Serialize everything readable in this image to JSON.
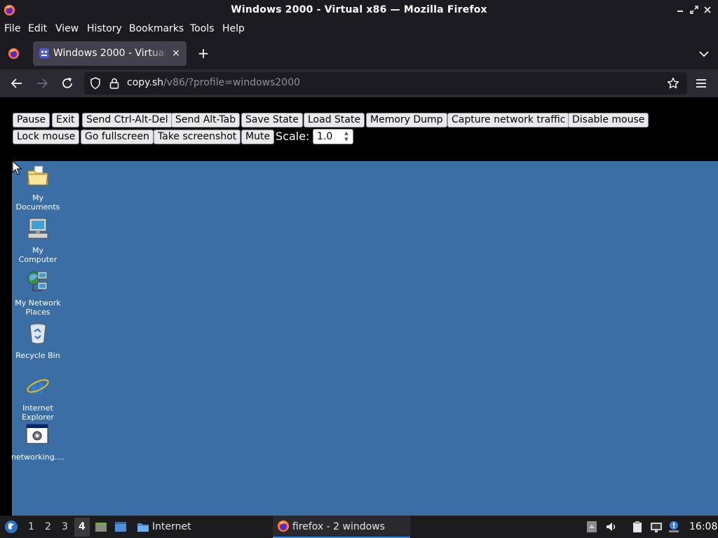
{
  "window": {
    "title": "Windows 2000 - Virtual x86 — Mozilla Firefox",
    "controls": [
      "minimize",
      "maximize",
      "close"
    ]
  },
  "menubar": {
    "items": [
      "File",
      "Edit",
      "View",
      "History",
      "Bookmarks",
      "Tools",
      "Help"
    ]
  },
  "tabs": {
    "active": {
      "label": "Windows 2000 - Virtual x86",
      "close": "×"
    },
    "new_tab": "+"
  },
  "navbar": {
    "url_host": "copy.sh",
    "url_path": "/v86/?profile=windows2000"
  },
  "emulator": {
    "buttons_row1": [
      "Pause",
      "Exit",
      "Send Ctrl-Alt-Del",
      "Send Alt-Tab",
      "Save State",
      "Load State",
      "Memory Dump",
      "Capture network traffic",
      "Disable mouse"
    ],
    "buttons_row2": [
      "Lock mouse",
      "Go fullscreen",
      "Take screenshot",
      "Mute"
    ],
    "scale_label": "Scale:",
    "scale_value": "1.0"
  },
  "desktop": {
    "background": "#3a6ea5",
    "icons": [
      {
        "label": "My Documents",
        "icon": "folder-documents-icon"
      },
      {
        "label": "My Computer",
        "icon": "computer-icon"
      },
      {
        "label": "My Network Places",
        "icon": "network-places-icon"
      },
      {
        "label": "Recycle Bin",
        "icon": "recycle-bin-icon"
      },
      {
        "label": "Internet Explorer",
        "icon": "internet-explorer-icon"
      },
      {
        "label": "networking....",
        "icon": "program-window-icon"
      }
    ]
  },
  "panel": {
    "workspaces": [
      "1",
      "2",
      "3",
      "4"
    ],
    "active_workspace": "4",
    "internet_label": "Internet",
    "task_label": "firefox - 2 windows",
    "clock": "16:08"
  },
  "colors": {
    "firefox_dark": "#1c1b22",
    "navbar": "#2b2a33",
    "accent": "#3584e4"
  }
}
